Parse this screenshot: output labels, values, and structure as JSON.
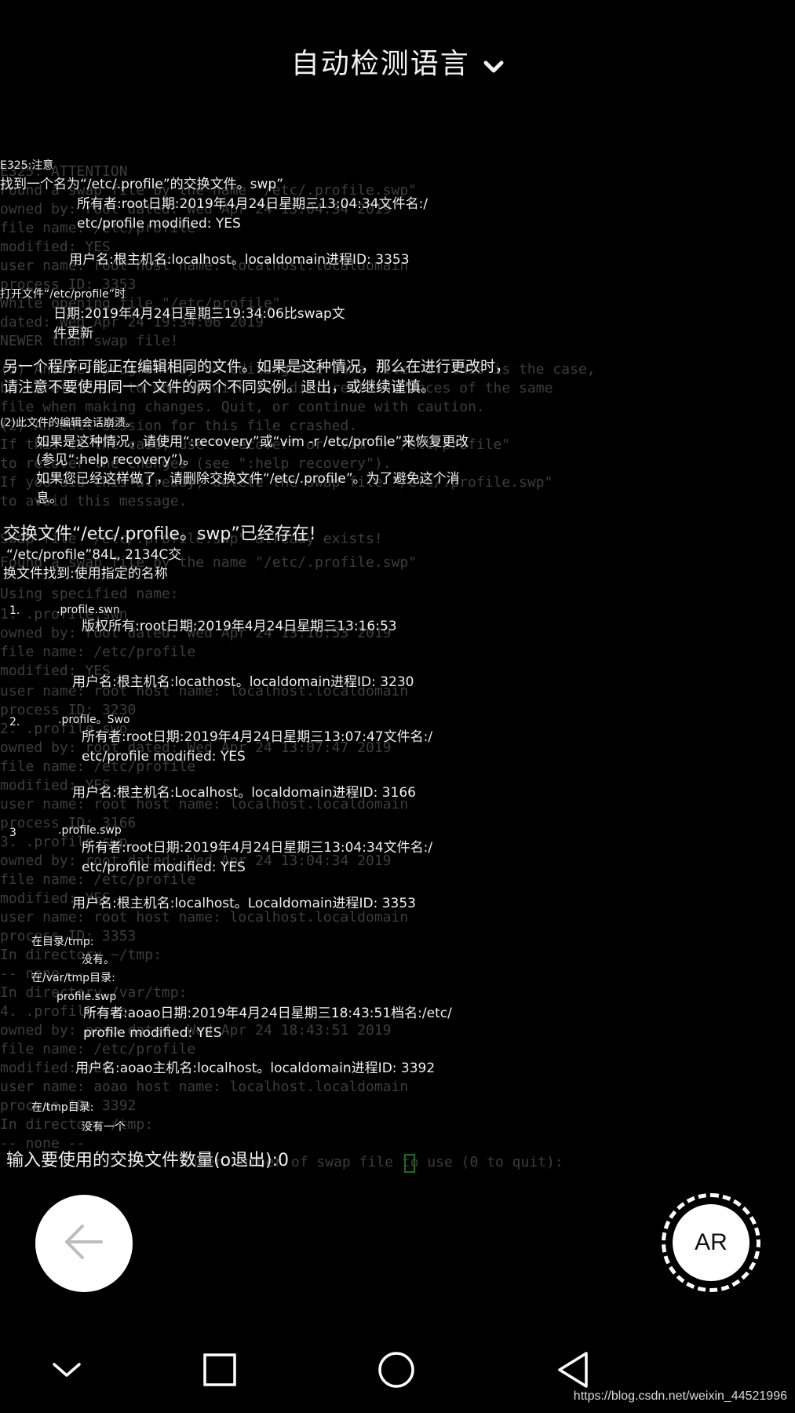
{
  "header": {
    "language_label": "自动检测语言"
  },
  "ghost_lines": [
    "E325: ATTENTION",
    "Found a swap file by the name \"/etc/.profile.swp\"",
    "          owned by: root   dated: Wed Apr 24 13:04:34 2019",
    "         file name: /etc/profile",
    "          modified: YES",
    "         user name: root   host name: localhost.localdomain",
    "        process ID: 3353",
    "While opening file \"/etc/profile\"",
    "             dated: Wed Apr 24 19:34:06 2019",
    "      NEWER than swap file!",
    "(1) Another program may be editing the same file.  If this is the case,",
    "    be careful not to end up with two different instances of the same",
    "    file when making changes.  Quit, or continue with caution.",
    "(2) An edit session for this file crashed.",
    "    If this is the case, use \":recover\" or \"vim -r /etc/profile\"",
    "    to recover the changes (see \":help recovery\").",
    "    If you did this already, delete the swap file \"/etc/.profile.swp\"",
    "    to avoid this message.",
    "Swap file \"/etc/.profile.swp\" already exists!",
    "Found a swap file by the name \"/etc/.profile.swp\"",
    "   Using specified name:",
    "1.    .profile.swn",
    "          owned by: root   dated: Wed Apr 24 13:16:53 2019",
    "         file name: /etc/profile",
    "          modified: YES",
    "         user name: root   host name: localhost.localdomain",
    "        process ID: 3230",
    "2.    .profile.swo",
    "          owned by: root   dated: Wed Apr 24 13:07:47 2019",
    "         file name: /etc/profile",
    "          modified: YES",
    "         user name: root   host name: localhost.localdomain",
    "        process ID: 3166",
    "3.    .profile.swp",
    "          owned by: root   dated: Wed Apr 24 13:04:34 2019",
    "         file name: /etc/profile",
    "          modified: YES",
    "         user name: root   host name: localhost.localdomain",
    "        process ID: 3353",
    "   In directory ~/tmp:",
    "      -- none --",
    "   In directory /var/tmp:",
    "4.    .profile.swp",
    "          owned by: aoao   dated: Wed Apr 24 18:43:51 2019",
    "         file name: /etc/profile",
    "          modified: YES",
    "         user name: aoao   host name: localhost.localdomain",
    "        process ID: 3392",
    "   In directory /tmp:",
    "      -- none --",
    "Enter number of swap file to use (0 to quit):"
  ],
  "translated_lines": [
    "E325:注意",
    "找到一个名为“/etc/.profile”的交换文件。swp”",
    "所有者:root日期:2019年4月24日星期三13:04:34文件名:/",
    "etc/profile modified: YES",
    "用户名:根主机名:localhost。localdomain进程ID: 3353",
    "打开文件“/etc/profile”时",
    "日期:2019年4月24日星期三19:34:06比swap文",
    "件更新",
    "另一个程序可能正在编辑相同的文件。如果是这种情况，那么在进行更改时，",
    "请注意不要使用同一个文件的两个不同实例。退出，或继续谨慎。",
    "(2)此文件的编辑会话崩溃。",
    "如果是这种情况，请使用“:recovery”或“vim -r /etc/profile”来恢复更改",
    "(参见“:help recovery”)。",
    "如果您已经这样做了，请删除交换文件“/etc/.profile”。为了避免这个消",
    "息。",
    "交换文件“/etc/.profile。swp”已经存在!",
    "“/etc/profile”84L, 2134C交",
    "换文件找到:使用指定的名称",
    "1.",
    ".profile.swn",
    "版权所有:root日期:2019年4月24日星期三13:16:53",
    "用户名:根主机名:locathost。localdomain进程ID: 3230",
    "2.",
    ".profile。Swo",
    "所有者:root日期:2019年4月24日星期三13:07:47文件名:/",
    "etc/profile modified: YES",
    "用户名:根主机名:Localhost。localdomain进程ID: 3166",
    "3",
    ".profile.swp",
    "所有者:root日期:2019年4月24日星期三13:04:34文件名:/",
    "etc/profile modified: YES",
    "用户名:根主机名:localhost。Localdomain进程ID: 3353",
    "在目录/tmp:",
    "没有。",
    "在/var/tmp目录:",
    "profile.swp",
    "所有者:aoao日期:2019年4月24日星期三18:43:51档名:/etc/",
    "profile modified: YES",
    "用户名:aoao主机名:localhost。localdomain进程ID: 3392",
    "在/tmp目录:",
    "没有一个",
    "输入要使用的交换文件数量(o退出):0"
  ],
  "buttons": {
    "ar_label": "AR"
  },
  "watermark": "https://blog.csdn.net/weixin_44521996"
}
